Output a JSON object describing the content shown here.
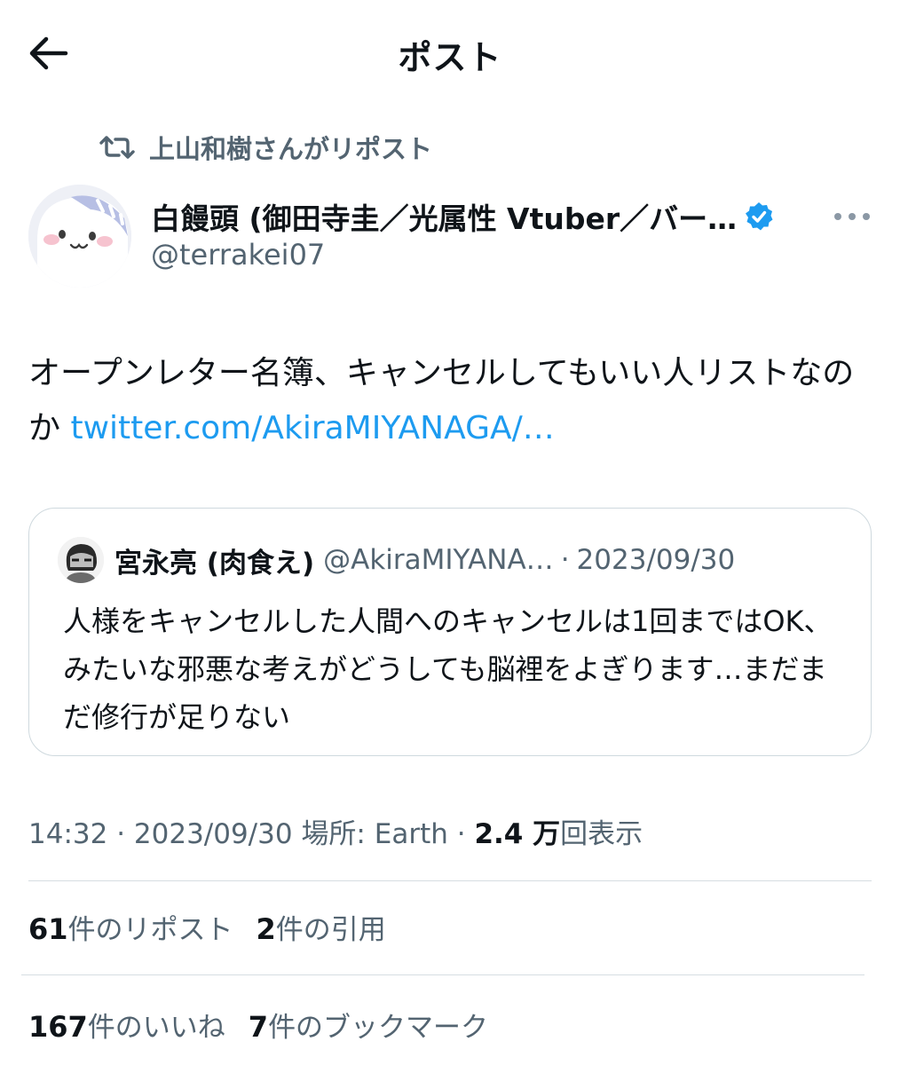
{
  "header": {
    "title": "ポスト"
  },
  "repost": {
    "label": "上山和樹さんがリポスト"
  },
  "author": {
    "name": "白饅頭 (御田寺圭／光属性 Vtuber／バー…",
    "handle": "@terrakei07",
    "verified": true
  },
  "post": {
    "text": "オープンレター名簿、キャンセルしてもいい人リストなのか ",
    "link": "twitter.com/AkiraMIYANAGA/…"
  },
  "quote": {
    "name": "宮永亮 (肉食え)",
    "handle": "@AkiraMIYANA…",
    "separator": "·",
    "date": "2023/09/30",
    "text": "人様をキャンセルした人間へのキャンセルは1回まではOK、みたいな邪悪な考えがどうしても脳裡をよぎります…まだまだ修行が足りない"
  },
  "meta": {
    "time": "14:32 · 2023/09/30",
    "location": "場所: Earth · ",
    "views_count": "2.4 万",
    "views_label": "回表示"
  },
  "stats": {
    "reposts_count": "61",
    "reposts_label": "件のリポスト",
    "quotes_count": "2",
    "quotes_label": "件の引用",
    "likes_count": "167",
    "likes_label": "件のいいね",
    "bookmarks_count": "7",
    "bookmarks_label": "件のブックマーク"
  },
  "colors": {
    "link": "#1d9bf0",
    "secondary_text": "#536471",
    "primary_text": "#0f1419",
    "border": "#cfd9de"
  },
  "icons": {
    "back": "arrow-left-icon",
    "repost": "repost-icon",
    "verified": "verified-badge-icon",
    "more": "more-icon"
  }
}
